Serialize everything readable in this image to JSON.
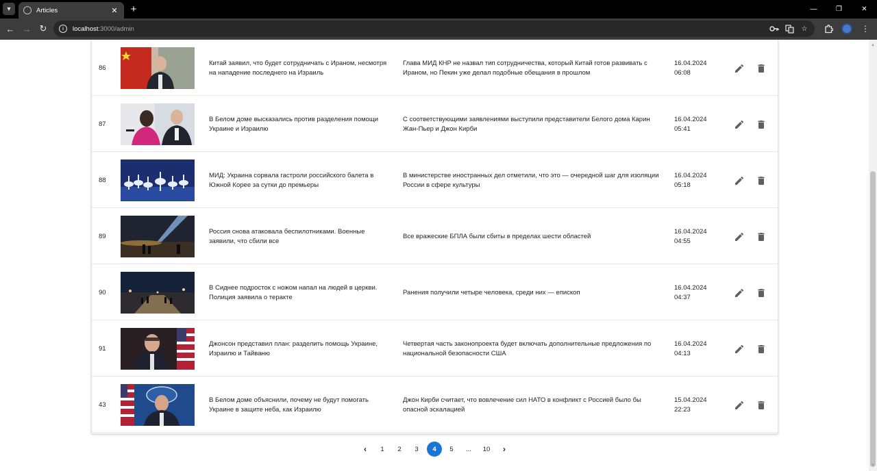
{
  "browser": {
    "tab_title": "Articles",
    "url_host": "localhost",
    "url_rest": ":3000/admin"
  },
  "icons": {
    "tab_menu": "chevron-down-icon",
    "tab_close": "close-icon",
    "new_tab": "plus-icon",
    "back": "arrow-left-icon",
    "forward": "arrow-right-icon",
    "reload": "reload-icon",
    "edit": "pencil-icon",
    "delete": "trash-icon",
    "prev_page": "chevron-left-icon",
    "next_page": "chevron-right-icon"
  },
  "colors": {
    "accent": "#1976d2",
    "action_icon": "#5f5f5f"
  },
  "articles": [
    {
      "id": "86",
      "title": "Китай заявил, что будет сотрудничать с Ираном, несмотря на нападение последнего на Израиль",
      "description": "Глава МИД КНР не назвал тип сотрудничества, который Китай готов развивать с Ираном, но Пекин уже делал подобные обещания в прошлом",
      "date": "16.04.2024",
      "time": "06:08",
      "thumb": "diplomat-flag"
    },
    {
      "id": "87",
      "title": "В Белом доме высказались против разделения помощи Украине и Израилю",
      "description": "С соответствующими заявлениями выступили представители Белого дома Карин Жан-Пьер и Джон Кирби",
      "date": "16.04.2024",
      "time": "05:41",
      "thumb": "briefing-pair"
    },
    {
      "id": "88",
      "title": "МИД: Украина сорвала гастроли российского балета в Южной Корее за сутки до премьеры",
      "description": "В министерстве иностранных дел отметили, что это — очередной шаг для изоляции России в сфере культуры",
      "date": "16.04.2024",
      "time": "05:18",
      "thumb": "ballet-stage"
    },
    {
      "id": "89",
      "title": "Россия снова атаковала беспилотниками. Военные заявили, что сбили все",
      "description": "Все вражеские БПЛА были сбиты в пределах шести областей",
      "date": "16.04.2024",
      "time": "04:55",
      "thumb": "night-searchlight"
    },
    {
      "id": "90",
      "title": "В Сиднее подросток с ножом напал на людей в церкви. Полиция заявила о теракте",
      "description": "Ранения получили четыре человека, среди них — епископ",
      "date": "16.04.2024",
      "time": "04:37",
      "thumb": "night-street"
    },
    {
      "id": "91",
      "title": "Джонсон представил план: разделить помощь Украине, Израилю и Тайваню",
      "description": "Четвертая часть законопроекта будет включать дополнительные предложения по национальной безопасности США",
      "date": "16.04.2024",
      "time": "04:13",
      "thumb": "speaker-flag"
    },
    {
      "id": "43",
      "title": "В Белом доме объяснили, почему не будут помогать Украине в защите неба, как Израилю",
      "description": "Джон Кирби считает, что вовлечение сил НАТО в конфликт с Россией было бы опасной эскалацией",
      "date": "15.04.2024",
      "time": "22:23",
      "thumb": "podium-seal"
    }
  ],
  "pagination": {
    "pages": [
      "1",
      "2",
      "3",
      "4",
      "5",
      "...",
      "10"
    ],
    "current": "4"
  }
}
